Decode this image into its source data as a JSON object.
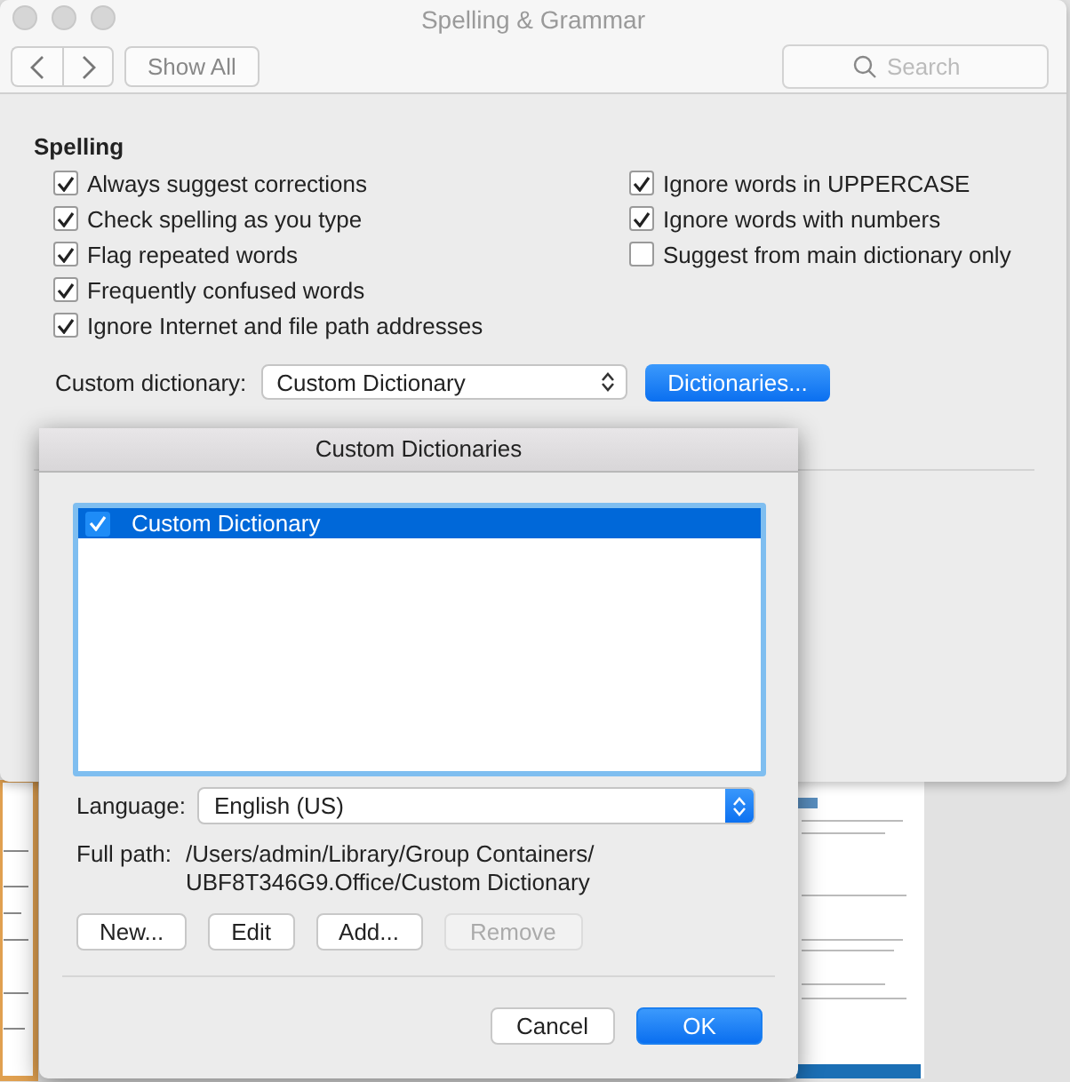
{
  "window": {
    "title": "Spelling & Grammar",
    "show_all": "Show All",
    "search": {
      "placeholder": "Search"
    }
  },
  "spelling": {
    "heading": "Spelling",
    "left_options": [
      {
        "label": "Always suggest corrections",
        "checked": true
      },
      {
        "label": "Check spelling as you type",
        "checked": true
      },
      {
        "label": "Flag repeated words",
        "checked": true
      },
      {
        "label": "Frequently confused words",
        "checked": true
      },
      {
        "label": "Ignore Internet and file path addresses",
        "checked": true
      }
    ],
    "right_options": [
      {
        "label": "Ignore words in UPPERCASE",
        "checked": true
      },
      {
        "label": "Ignore words with numbers",
        "checked": true
      },
      {
        "label": "Suggest from main dictionary only",
        "checked": false
      }
    ],
    "custom_dictionary": {
      "label": "Custom dictionary:",
      "value": "Custom Dictionary",
      "button": "Dictionaries..."
    }
  },
  "sheet": {
    "title": "Custom Dictionaries",
    "dictionaries": [
      {
        "name": "Custom Dictionary",
        "checked": true,
        "selected": true
      }
    ],
    "language": {
      "label": "Language:",
      "value": "English (US)"
    },
    "full_path": {
      "label": "Full path:",
      "lines": [
        "/Users/admin/Library/Group Containers/",
        "UBF8T346G9.Office/Custom Dictionary"
      ]
    },
    "actions": [
      {
        "label": "New...",
        "disabled": false
      },
      {
        "label": "Edit",
        "disabled": false
      },
      {
        "label": "Add...",
        "disabled": false
      },
      {
        "label": "Remove",
        "disabled": true
      }
    ],
    "buttons": [
      {
        "label": "Cancel",
        "default": false
      },
      {
        "label": "OK",
        "default": true
      }
    ]
  }
}
